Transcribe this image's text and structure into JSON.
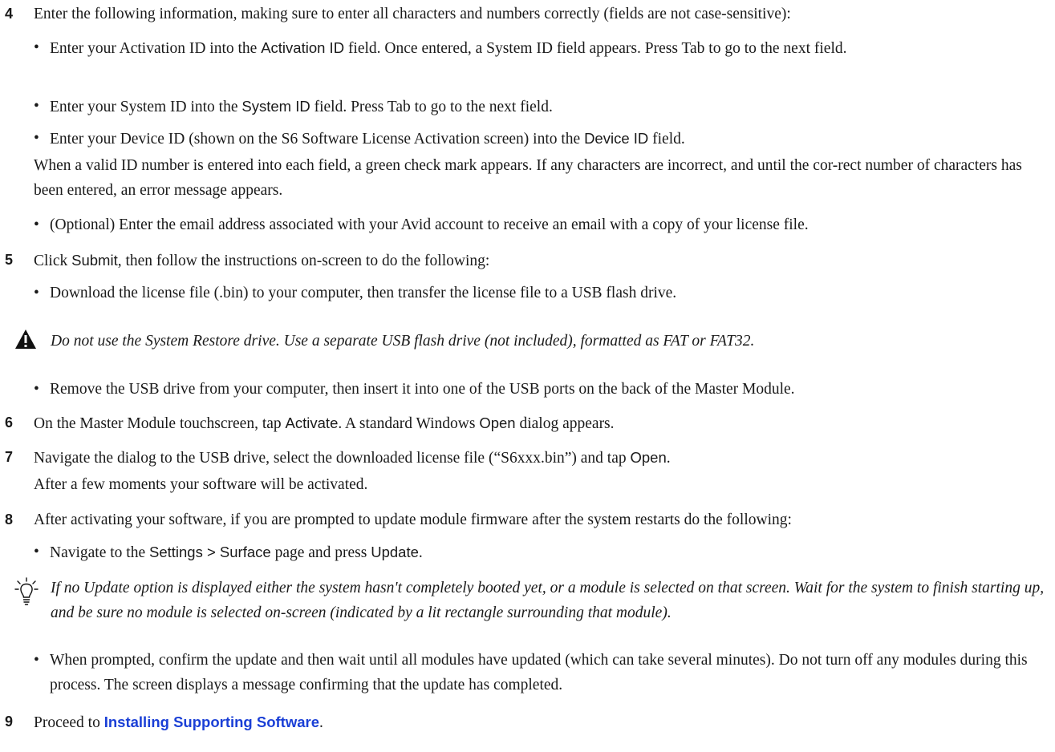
{
  "step4": {
    "number": "4",
    "text": "Enter the following information, making sure to enter all characters and numbers correctly (fields are not case-sensitive):",
    "b1": {
      "t1": "Enter your Activation ID into the ",
      "ui1": "Activation ID",
      "t2": " field. Once entered, a System ID field appears. Press Tab to go to the next field."
    },
    "b2": {
      "t1": "Enter your System ID into the ",
      "ui1": "System ID",
      "t2": " field. Press Tab to go to the next field."
    },
    "b3": {
      "t1": "Enter your Device ID (shown on the S6 Software License Activation screen) into the ",
      "ui1": "Device ID",
      "t2": " field."
    },
    "para": "When a valid ID number is entered into each field, a green check mark appears. If any characters are incorrect, and until the cor-rect number of characters has been entered, an error message appears.",
    "b4": "(Optional) Enter the email address associated with your Avid account to receive an email with a copy of your license file."
  },
  "step5": {
    "number": "5",
    "t1": "Click ",
    "ui1": "Submit",
    "t2": ", then follow the instructions on-screen to do the following:",
    "b1": "Download the license file (.bin) to your computer, then transfer the license file to a USB flash drive.",
    "warning": "Do not use the System Restore drive. Use a separate USB flash drive (not included), formatted as FAT or FAT32.",
    "b2": "Remove the USB drive from your computer, then insert it into one of the USB ports on the back of the Master Module."
  },
  "step6": {
    "number": "6",
    "t1": "On the Master Module touchscreen, tap ",
    "ui1": "Activate",
    "t2": ". A standard Windows ",
    "ui2": "Open",
    "t3": " dialog appears."
  },
  "step7": {
    "number": "7",
    "t1": "Navigate the dialog to the USB drive, select the downloaded license file (“S6xxx.bin”) and tap ",
    "ui1": "Open",
    "t2": ".",
    "para": "After a few moments your software will be activated."
  },
  "step8": {
    "number": "8",
    "text": "After activating your software, if you are prompted to update module firmware after the system restarts do the following:",
    "b1": {
      "t1": "Navigate to the ",
      "ui1": "Settings > Surface",
      "t2": " page and press ",
      "ui2": "Update",
      "t3": "."
    },
    "tip": "If no Update option is displayed either the system hasn't completely booted yet, or a module is selected on that screen. Wait for the system to finish starting up, and be sure no module is selected on-screen (indicated by a lit rectangle surrounding that module).",
    "b2": "When prompted, confirm the update and then wait until all modules have updated (which can take several minutes). Do not turn off any modules during this process. The screen displays a message confirming that the update has completed."
  },
  "step9": {
    "number": "9",
    "t1": "Proceed to ",
    "link": "Installing Supporting Software",
    "t2": "."
  },
  "bullet_char": "•",
  "colors": {
    "link": "#1a3fd6",
    "text": "#1a1a1a"
  },
  "icons": {
    "warning": "warning-triangle-icon",
    "tip": "lightbulb-icon"
  }
}
